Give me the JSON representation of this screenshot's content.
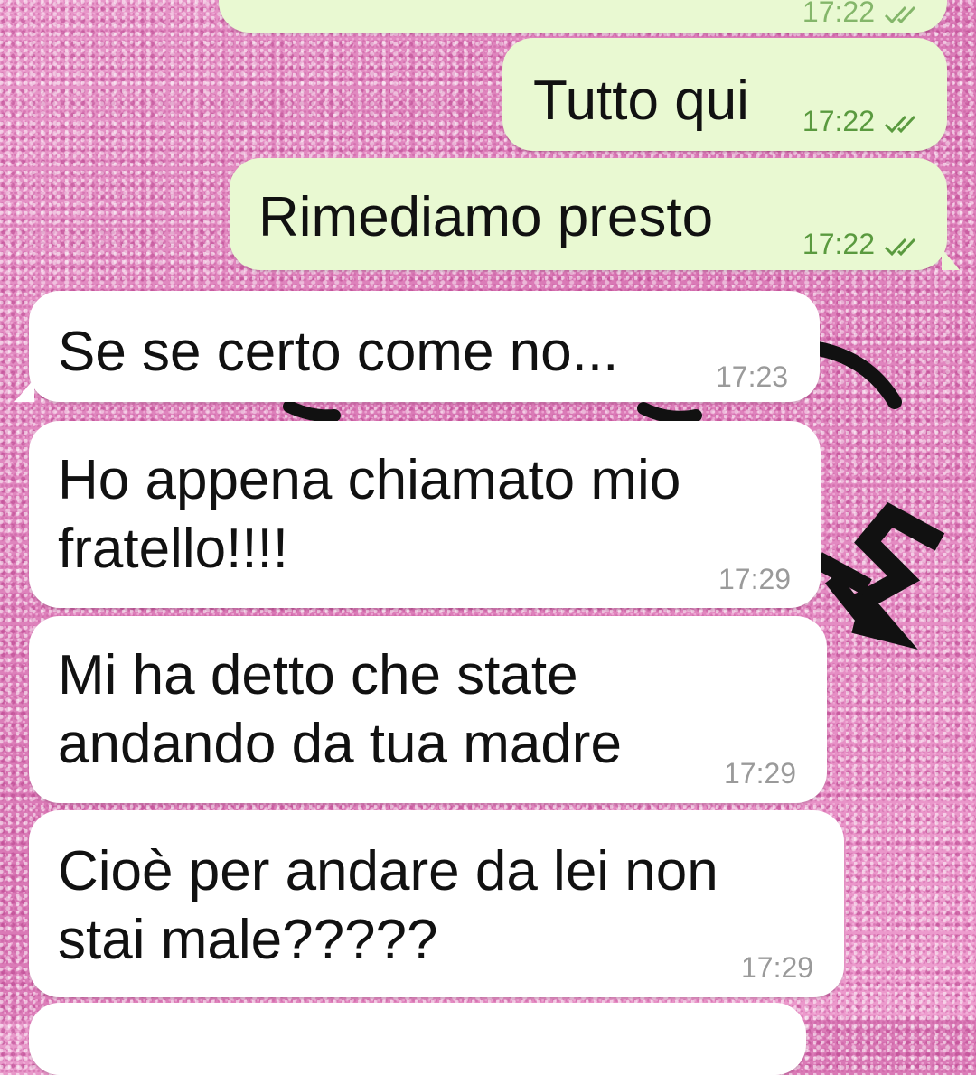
{
  "conversation": {
    "messages": [
      {
        "direction": "outgoing",
        "text": "",
        "time": "17:22",
        "status": "read-double-check-icon"
      },
      {
        "direction": "outgoing",
        "text": "Tutto qui",
        "time": "17:22",
        "status": "read-double-check-icon"
      },
      {
        "direction": "outgoing",
        "text": "Rimediamo presto",
        "time": "17:22",
        "status": "read-double-check-icon"
      },
      {
        "direction": "incoming",
        "text": "Se se certo come no...",
        "time": "17:23"
      },
      {
        "direction": "incoming",
        "text": "Ho appena chiamato mio\nfratello!!!!",
        "time": "17:29"
      },
      {
        "direction": "incoming",
        "text": "Mi ha detto che state\nandando da tua madre",
        "time": "17:29"
      },
      {
        "direction": "incoming",
        "text": "Cioè per andare da lei non\nstai male?????",
        "time": "17:29"
      },
      {
        "direction": "incoming",
        "text": "",
        "time": ""
      }
    ]
  },
  "colors": {
    "wallpaper": "#e48fc4",
    "outgoing_bubble": "#e9f9d2",
    "incoming_bubble": "#ffffff",
    "outgoing_time": "#5a9a3f",
    "incoming_time": "#9a9a9a",
    "text": "#111111"
  }
}
